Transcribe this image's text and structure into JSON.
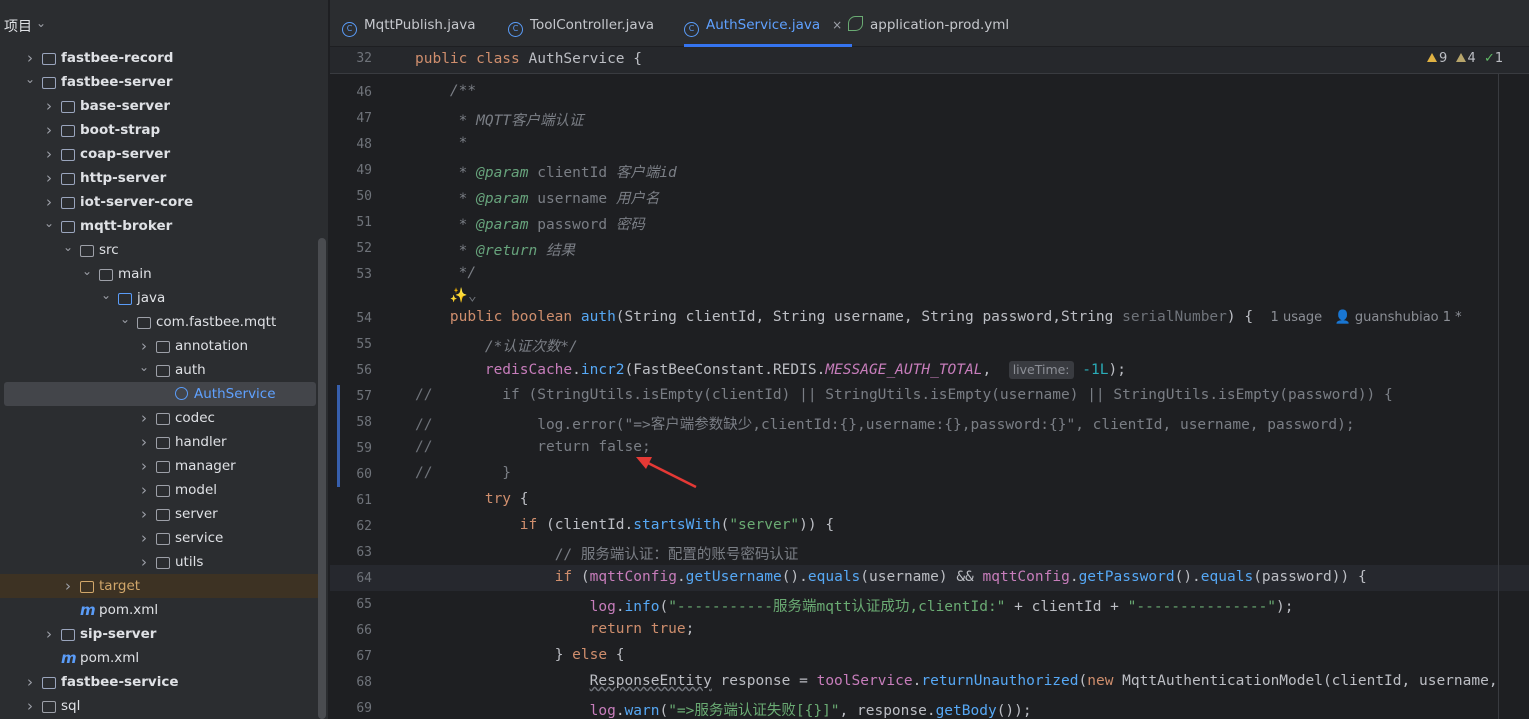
{
  "sidebar": {
    "title": "项目",
    "items": [
      {
        "label": "fastbee-record",
        "level": 1,
        "arrow": "›",
        "icon": "module-folder-icon",
        "bold": true
      },
      {
        "label": "fastbee-server",
        "level": 1,
        "arrow": "⌄",
        "icon": "module-folder-icon",
        "bold": true
      },
      {
        "label": "base-server",
        "level": 2,
        "arrow": "›",
        "icon": "module-folder-icon",
        "bold": true
      },
      {
        "label": "boot-strap",
        "level": 2,
        "arrow": "›",
        "icon": "module-folder-icon",
        "bold": true
      },
      {
        "label": "coap-server",
        "level": 2,
        "arrow": "›",
        "icon": "module-folder-icon",
        "bold": true
      },
      {
        "label": "http-server",
        "level": 2,
        "arrow": "›",
        "icon": "module-folder-icon",
        "bold": true
      },
      {
        "label": "iot-server-core",
        "level": 2,
        "arrow": "›",
        "icon": "module-folder-icon",
        "bold": true
      },
      {
        "label": "mqtt-broker",
        "level": 2,
        "arrow": "⌄",
        "icon": "module-folder-icon",
        "bold": true
      },
      {
        "label": "src",
        "level": 3,
        "arrow": "⌄",
        "icon": "folder-icon",
        "bold": false
      },
      {
        "label": "main",
        "level": 4,
        "arrow": "⌄",
        "icon": "folder-icon",
        "bold": false
      },
      {
        "label": "java",
        "level": 5,
        "arrow": "⌄",
        "icon": "source-folder-icon",
        "bold": false
      },
      {
        "label": "com.fastbee.mqtt",
        "level": 6,
        "arrow": "⌄",
        "icon": "package-icon",
        "bold": false
      },
      {
        "label": "annotation",
        "level": 7,
        "arrow": "›",
        "icon": "package-icon",
        "bold": false
      },
      {
        "label": "auth",
        "level": 7,
        "arrow": "⌄",
        "icon": "package-icon",
        "bold": false
      },
      {
        "label": "AuthService",
        "level": 8,
        "arrow": "",
        "icon": "class-icon",
        "bold": false,
        "selected": true
      },
      {
        "label": "codec",
        "level": 7,
        "arrow": "›",
        "icon": "package-icon",
        "bold": false
      },
      {
        "label": "handler",
        "level": 7,
        "arrow": "›",
        "icon": "package-icon",
        "bold": false
      },
      {
        "label": "manager",
        "level": 7,
        "arrow": "›",
        "icon": "package-icon",
        "bold": false
      },
      {
        "label": "model",
        "level": 7,
        "arrow": "›",
        "icon": "package-icon",
        "bold": false
      },
      {
        "label": "server",
        "level": 7,
        "arrow": "›",
        "icon": "package-icon",
        "bold": false
      },
      {
        "label": "service",
        "level": 7,
        "arrow": "›",
        "icon": "package-icon",
        "bold": false
      },
      {
        "label": "utils",
        "level": 7,
        "arrow": "›",
        "icon": "package-icon",
        "bold": false
      },
      {
        "label": "target",
        "level": 3,
        "arrow": "›",
        "icon": "excluded-folder-icon",
        "bold": false,
        "target": true
      },
      {
        "label": "pom.xml",
        "level": 3,
        "arrow": "",
        "icon": "maven-icon",
        "bold": false
      },
      {
        "label": "sip-server",
        "level": 2,
        "arrow": "›",
        "icon": "module-folder-icon",
        "bold": true
      },
      {
        "label": "pom.xml",
        "level": 2,
        "arrow": "",
        "icon": "maven-icon",
        "bold": false
      },
      {
        "label": "fastbee-service",
        "level": 1,
        "arrow": "›",
        "icon": "module-folder-icon",
        "bold": true
      },
      {
        "label": "sql",
        "level": 1,
        "arrow": "›",
        "icon": "folder-icon",
        "bold": false
      }
    ]
  },
  "tabs": [
    {
      "label": "MqttPublish.java",
      "icon": "java-class-icon",
      "active": false
    },
    {
      "label": "ToolController.java",
      "icon": "java-class-icon",
      "active": false
    },
    {
      "label": "AuthService.java",
      "icon": "java-class-icon",
      "active": true,
      "close": "×"
    },
    {
      "label": "application-prod.yml",
      "icon": "yaml-icon",
      "active": false
    }
  ],
  "inspection": {
    "warnings": "9",
    "weak_warnings": "4",
    "ok": "1"
  },
  "editor": {
    "sticky": {
      "line": "32",
      "code": "public class AuthService {"
    },
    "lines": [
      {
        "n": "46",
        "segs": [
          [
            "    "
          ],
          [
            "/**",
            "cm"
          ]
        ]
      },
      {
        "n": "47",
        "segs": [
          [
            "     "
          ],
          [
            "* MQTT客户端认证",
            "cm"
          ]
        ]
      },
      {
        "n": "48",
        "segs": [
          [
            "     "
          ],
          [
            "*",
            "cm"
          ]
        ]
      },
      {
        "n": "49",
        "segs": [
          [
            "     "
          ],
          [
            "* ",
            "cm"
          ],
          [
            "@param",
            "tag"
          ],
          [
            " clientId ",
            "cmp"
          ],
          [
            "客户端id",
            "cm"
          ]
        ]
      },
      {
        "n": "50",
        "segs": [
          [
            "     "
          ],
          [
            "* ",
            "cm"
          ],
          [
            "@param",
            "tag"
          ],
          [
            " username ",
            "cmp"
          ],
          [
            "用户名",
            "cm"
          ]
        ]
      },
      {
        "n": "51",
        "segs": [
          [
            "     "
          ],
          [
            "* ",
            "cm"
          ],
          [
            "@param",
            "tag"
          ],
          [
            " password ",
            "cmp"
          ],
          [
            "密码",
            "cm"
          ]
        ]
      },
      {
        "n": "52",
        "segs": [
          [
            "     "
          ],
          [
            "* ",
            "cm"
          ],
          [
            "@return",
            "tag"
          ],
          [
            " 结果",
            "cm"
          ]
        ]
      },
      {
        "n": "53",
        "segs": [
          [
            "     "
          ],
          [
            "*/",
            "cm"
          ]
        ]
      },
      {
        "n": "",
        "segs": [
          [
            "    "
          ],
          [
            "✨⌄",
            "dim"
          ]
        ]
      },
      {
        "n": "54",
        "segs": [
          [
            "    "
          ],
          [
            "public boolean ",
            "kw"
          ],
          [
            "auth",
            "fn"
          ],
          [
            "(String clientId, String username, String password,String "
          ],
          [
            "serialNumber",
            "dim"
          ],
          [
            ") {  "
          ],
          [
            "1 usage   👤 guanshubiao 1 *",
            "hintlens"
          ]
        ]
      },
      {
        "n": "55",
        "segs": [
          [
            "        "
          ],
          [
            "/*认证次数*/",
            "cm"
          ]
        ]
      },
      {
        "n": "56",
        "segs": [
          [
            "        "
          ],
          [
            "redisCache",
            "fld"
          ],
          [
            "."
          ],
          [
            "incr2",
            "fn"
          ],
          [
            "(FastBeeConstant.REDIS."
          ],
          [
            "MESSAGE_AUTH_TOTAL",
            "sfld"
          ],
          [
            ",  "
          ],
          [
            "liveTime:",
            "hint"
          ],
          [
            " "
          ],
          [
            "-1L",
            "num"
          ],
          [
            ");"
          ]
        ]
      },
      {
        "n": "57",
        "segs": [
          [
            "//",
            "dim"
          ],
          [
            "        if (StringUtils.isEmpty(clientId) || StringUtils.isEmpty(username) || StringUtils.isEmpty(password)) {",
            "cmp"
          ]
        ]
      },
      {
        "n": "58",
        "segs": [
          [
            "//",
            "dim"
          ],
          [
            "            log.error(\"=>客户端参数缺少,clientId:{},username:{},password:{}\", clientId, username, password);",
            "cmp"
          ]
        ]
      },
      {
        "n": "59",
        "segs": [
          [
            "//",
            "dim"
          ],
          [
            "            return false;",
            "cmp"
          ]
        ]
      },
      {
        "n": "60",
        "segs": [
          [
            "//",
            "dim"
          ],
          [
            "        }",
            "cmp"
          ]
        ]
      },
      {
        "n": "61",
        "segs": [
          [
            "        "
          ],
          [
            "try",
            "kw"
          ],
          [
            " {"
          ]
        ]
      },
      {
        "n": "62",
        "segs": [
          [
            "            "
          ],
          [
            "if",
            "kw"
          ],
          [
            " (clientId."
          ],
          [
            "startsWith",
            "fn"
          ],
          [
            "("
          ],
          [
            "\"server\"",
            "str"
          ],
          [
            ")) {"
          ]
        ]
      },
      {
        "n": "63",
        "segs": [
          [
            "                "
          ],
          [
            "// 服务端认证：配置的账号密码认证",
            "cmp"
          ]
        ]
      },
      {
        "n": "64",
        "segs": [
          [
            "                "
          ],
          [
            "if",
            "kw"
          ],
          [
            " ("
          ],
          [
            "mqttConfig",
            "fld"
          ],
          [
            "."
          ],
          [
            "getUsername",
            "fn"
          ],
          [
            "()."
          ],
          [
            "equals",
            "fn"
          ],
          [
            "(username) && "
          ],
          [
            "mqttConfig",
            "fld"
          ],
          [
            "."
          ],
          [
            "getPassword",
            "fn"
          ],
          [
            "()."
          ],
          [
            "equals",
            "fn"
          ],
          [
            "(password)) {"
          ]
        ]
      },
      {
        "n": "65",
        "segs": [
          [
            "                    "
          ],
          [
            "log",
            "fld"
          ],
          [
            "."
          ],
          [
            "info",
            "fn"
          ],
          [
            "("
          ],
          [
            "\"-----------服务端mqtt认证成功,clientId:\"",
            "str"
          ],
          [
            " + clientId + "
          ],
          [
            "\"---------------\"",
            "str"
          ],
          [
            ");"
          ]
        ]
      },
      {
        "n": "66",
        "segs": [
          [
            "                    "
          ],
          [
            "return true",
            "kw"
          ],
          [
            ";"
          ]
        ]
      },
      {
        "n": "67",
        "segs": [
          [
            "                "
          ],
          [
            "} "
          ],
          [
            "else",
            "kw"
          ],
          [
            " {"
          ]
        ]
      },
      {
        "n": "68",
        "segs": [
          [
            "                    "
          ],
          [
            "ResponseEntity",
            "underl"
          ],
          [
            " response = "
          ],
          [
            "toolService",
            "fld"
          ],
          [
            "."
          ],
          [
            "returnUnauthorized",
            "fn"
          ],
          [
            "("
          ],
          [
            "new",
            "kw"
          ],
          [
            " MqttAuthenticationModel(clientId, username,"
          ]
        ]
      },
      {
        "n": "69",
        "segs": [
          [
            "                    "
          ],
          [
            "log",
            "fld"
          ],
          [
            "."
          ],
          [
            "warn",
            "fn"
          ],
          [
            "("
          ],
          [
            "\"=>服务端认证失败[{}]\"",
            "str"
          ],
          [
            ", response."
          ],
          [
            "getBody",
            "fn"
          ],
          [
            "());"
          ]
        ]
      }
    ]
  },
  "colors": {
    "accent": "#3574f0",
    "annotation_arrow": "#e53935"
  }
}
